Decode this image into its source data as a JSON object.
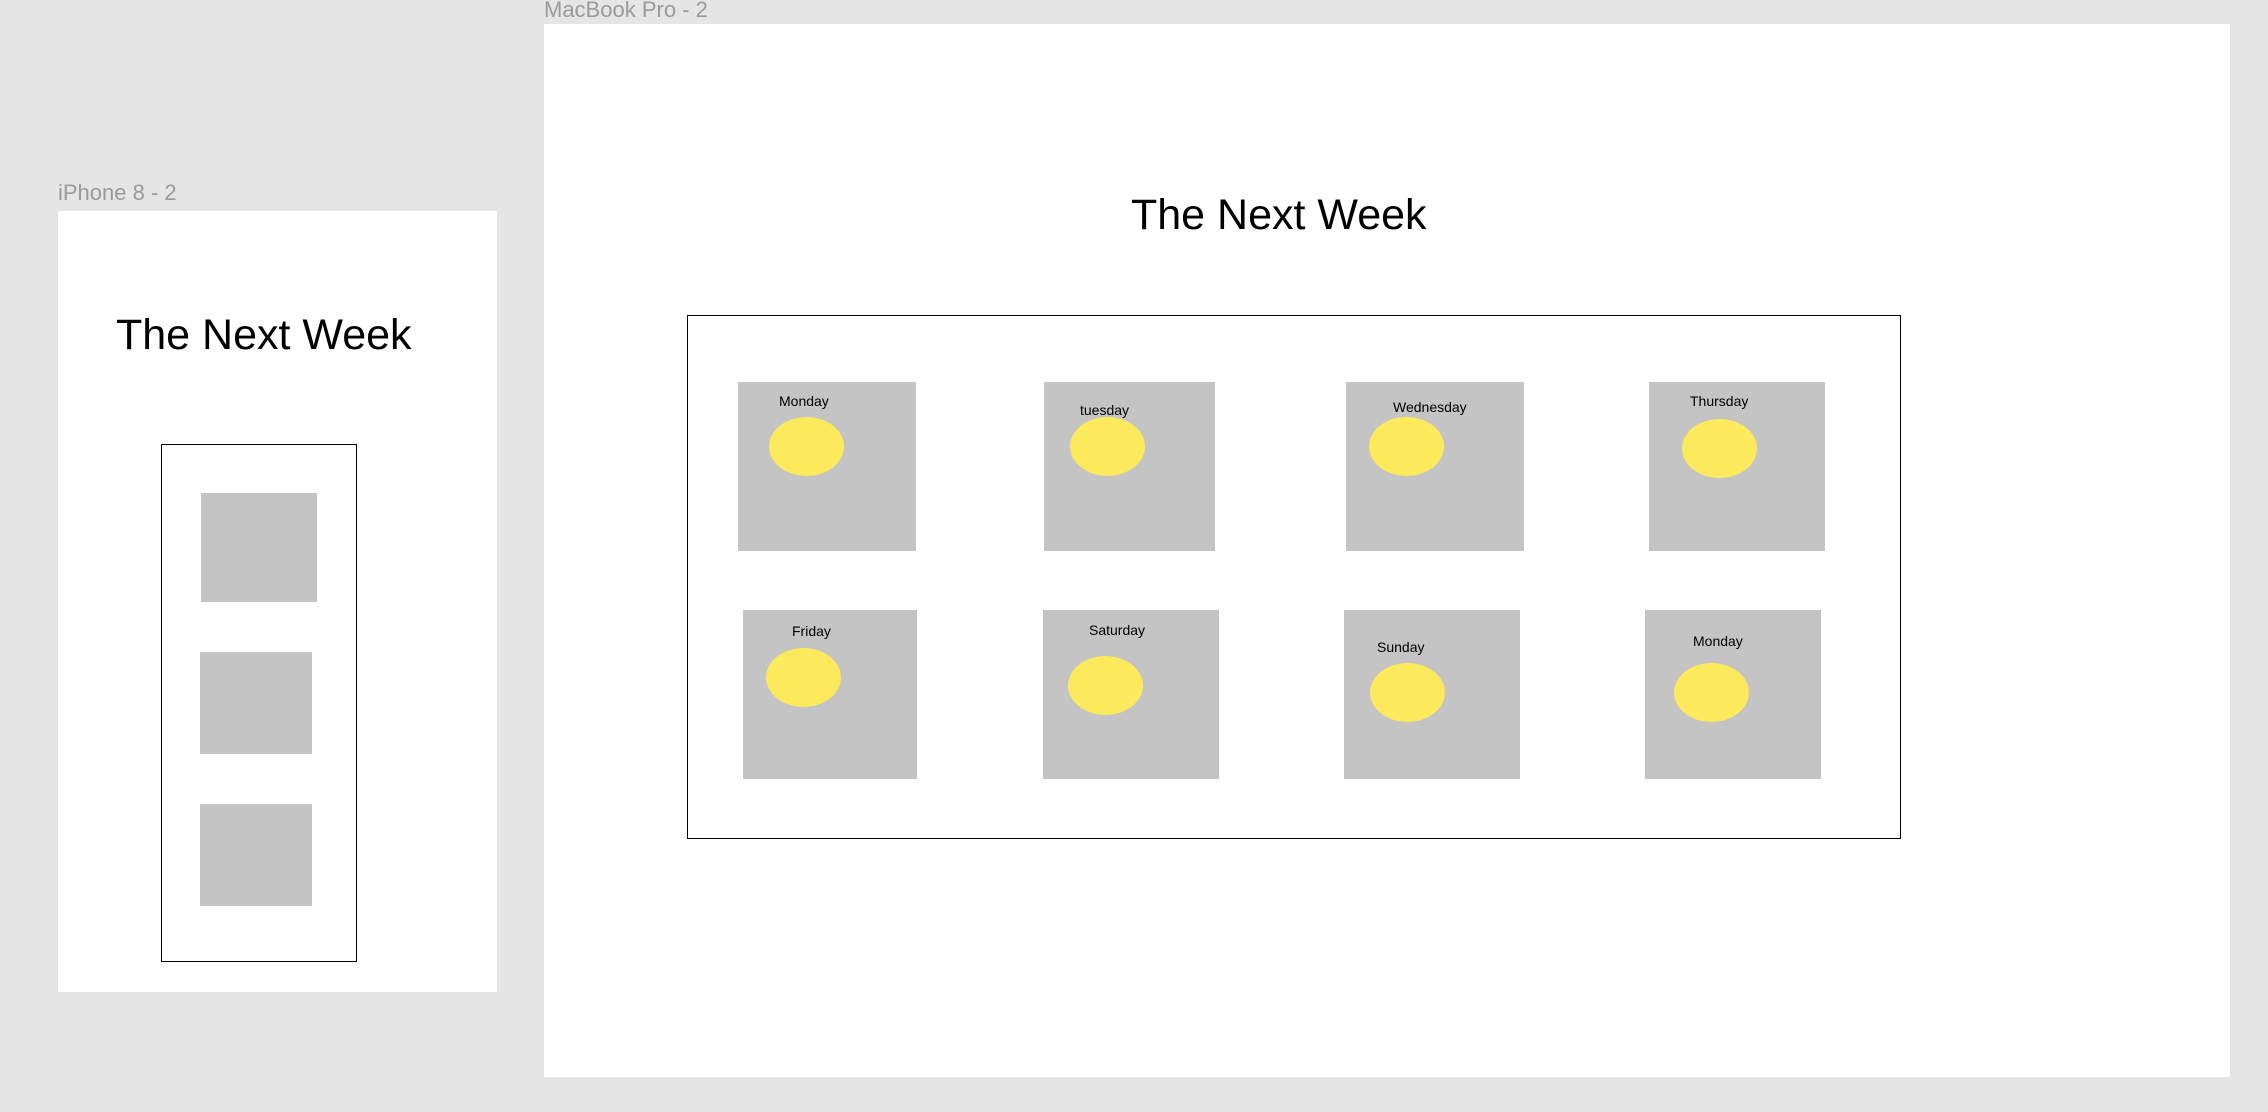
{
  "canvas": {
    "background": "#e5e5e5"
  },
  "iphone": {
    "frame_label": "iPhone 8 - 2",
    "title": "The Next Week",
    "tile_count": 3
  },
  "macbook": {
    "frame_label": "MacBook Pro - 2",
    "title": "The Next Week",
    "days": [
      {
        "label": "Monday"
      },
      {
        "label": "tuesday"
      },
      {
        "label": "Wednesday"
      },
      {
        "label": "Thursday"
      },
      {
        "label": "Friday"
      },
      {
        "label": "Saturday"
      },
      {
        "label": "Sunday"
      },
      {
        "label": "Monday"
      }
    ]
  },
  "colors": {
    "tile": "#c4c4c4",
    "sun": "#fde95c",
    "frame": "#ffffff",
    "label": "#9a9a9a"
  },
  "icons": {
    "sun": "sun-icon"
  }
}
